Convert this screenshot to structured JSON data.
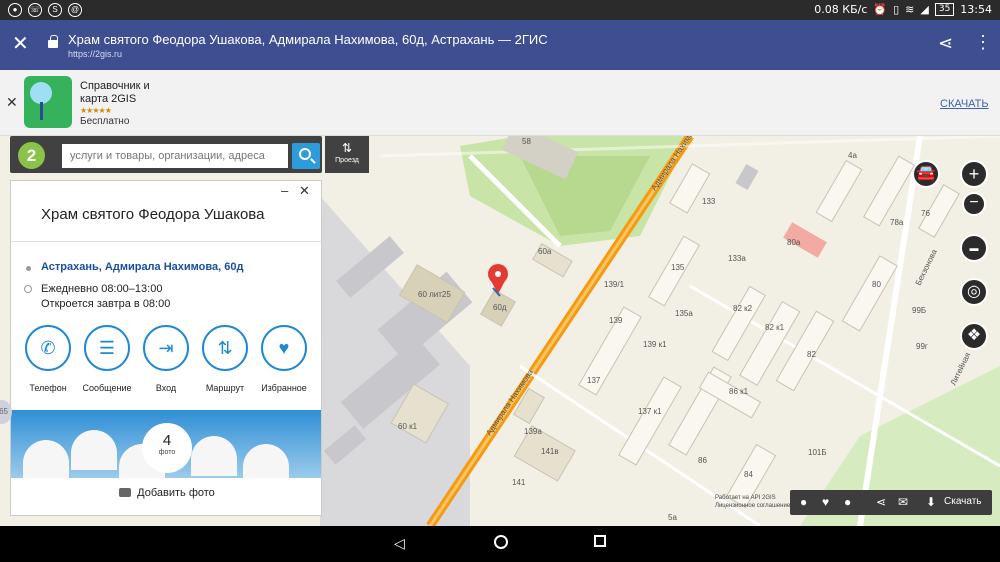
{
  "status_bar": {
    "icons": [
      "signal-icon",
      "viber-icon",
      "skype-icon",
      "at-icon"
    ],
    "network_speed": "0.08 КБ/с",
    "battery": "35",
    "time": "13:54"
  },
  "browser": {
    "page_title": "Храм святого Феодора Ушакова, Адмирала Нахимова, 60д, Астрахань — 2ГИС",
    "url": "https://2gis.ru"
  },
  "app_banner": {
    "name": "Справочник и карта 2GIS",
    "rating_stars": "★★★★★",
    "price": "Бесплатно",
    "download_label": "СКАЧАТЬ"
  },
  "search": {
    "logo": "2",
    "placeholder": "услуги и товары, организации, адреса",
    "route_label": "Проезд"
  },
  "card": {
    "title": "Храм святого Феодора Ушакова",
    "address": "Астрахань, Адмирала Нахимова, 60д",
    "hours": "Ежедневно 08:00–13:00",
    "opens_note": "Откроется завтра в 08:00",
    "actions": [
      {
        "label": "Телефон",
        "icon": "phone-icon"
      },
      {
        "label": "Сообщение",
        "icon": "message-icon"
      },
      {
        "label": "Вход",
        "icon": "entrance-icon"
      },
      {
        "label": "Маршрут",
        "icon": "route-icon"
      },
      {
        "label": "Избранное",
        "icon": "heart-icon"
      }
    ],
    "photo_count": "4",
    "photo_count_label": "фото",
    "add_photo_label": "Добавить фото"
  },
  "map": {
    "streets": [
      "Адмирала Нахимова",
      "Адмирала Нахимова",
      "Бехзонова",
      "Литейная"
    ],
    "building_labels": [
      "58",
      "60а",
      "60 лит25",
      "60д",
      "60 к1",
      "139/1",
      "139",
      "139 к1",
      "137",
      "137 к1",
      "139а",
      "141в",
      "141",
      "133",
      "135",
      "135а",
      "133а",
      "80а",
      "82 к2",
      "82 к1",
      "82",
      "80",
      "86 к1",
      "86",
      "84",
      "78а",
      "76",
      "4а",
      "99Б",
      "99г",
      "101Б",
      "5а"
    ],
    "watermark_line1": "Работает на API 2GIS",
    "watermark_line2": "Лицензионное соглашение",
    "toolbar_download": "Скачать",
    "side_handle": "65"
  }
}
